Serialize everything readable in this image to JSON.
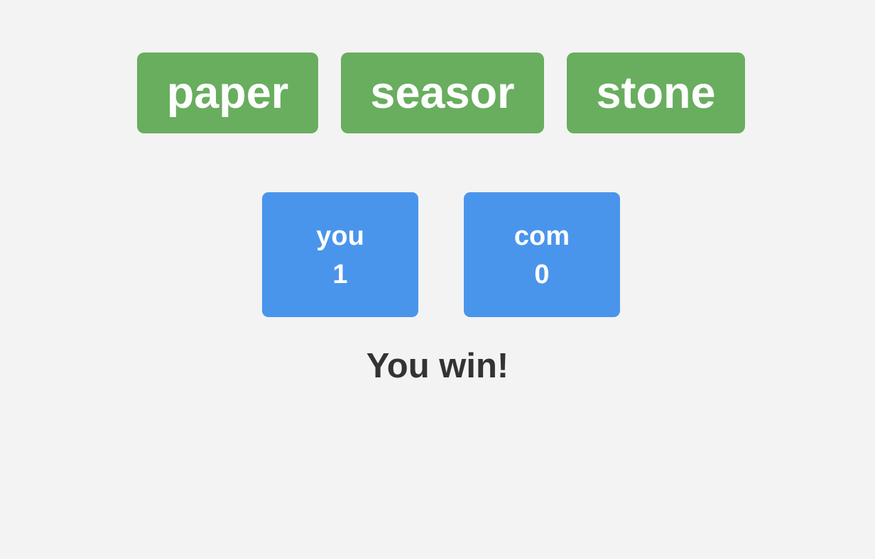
{
  "colors": {
    "background": "#f3f3f3",
    "choice_button": "#68ae5e",
    "score_card": "#4a95ec",
    "button_text": "#ffffff",
    "result_text": "#333333"
  },
  "choices": [
    {
      "label": "paper"
    },
    {
      "label": "seasor"
    },
    {
      "label": "stone"
    }
  ],
  "scores": {
    "you": {
      "label": "you",
      "value": "1"
    },
    "com": {
      "label": "com",
      "value": "0"
    }
  },
  "result": {
    "message": "You win!"
  }
}
